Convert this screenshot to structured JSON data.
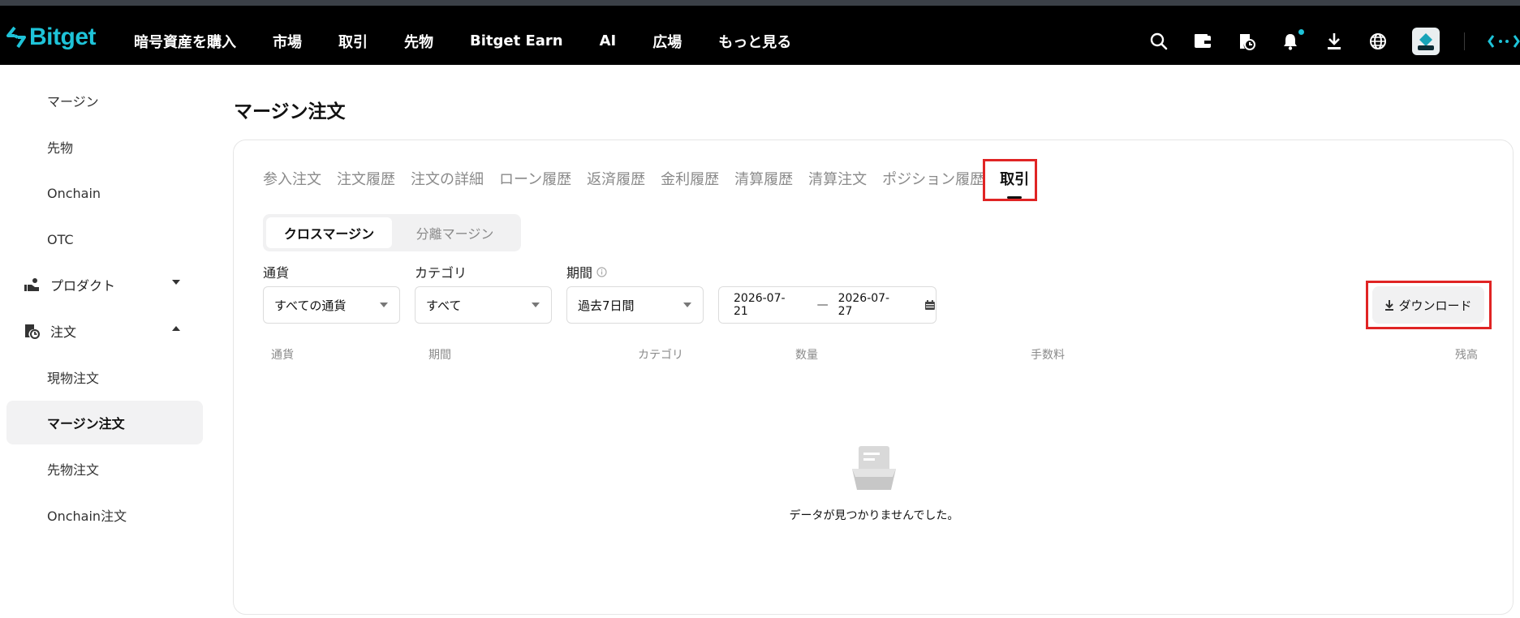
{
  "brand": {
    "name": "Bitget",
    "accent": "#1ec3d8"
  },
  "nav": [
    "暗号資産を購入",
    "市場",
    "取引",
    "先物",
    "Bitget Earn",
    "AI",
    "広場",
    "もっと見る"
  ],
  "top_icons": [
    "search-icon",
    "wallet-icon",
    "order-history-icon",
    "bell-icon",
    "download-icon",
    "globe-icon",
    "avatar",
    "translate-icon"
  ],
  "sidebar": {
    "items": [
      {
        "label": "マージン",
        "type": "sub"
      },
      {
        "label": "先物",
        "type": "sub"
      },
      {
        "label": "Onchain",
        "type": "sub"
      },
      {
        "label": "OTC",
        "type": "sub"
      },
      {
        "label": "プロダクト",
        "type": "group",
        "expanded": false
      },
      {
        "label": "注文",
        "type": "group",
        "expanded": true
      },
      {
        "label": "現物注文",
        "type": "sub"
      },
      {
        "label": "マージン注文",
        "type": "sub",
        "active": true
      },
      {
        "label": "先物注文",
        "type": "sub"
      },
      {
        "label": "Onchain注文",
        "type": "sub"
      }
    ]
  },
  "page": {
    "title": "マージン注文"
  },
  "tabs": [
    {
      "label": "参入注文"
    },
    {
      "label": "注文履歴"
    },
    {
      "label": "注文の詳細"
    },
    {
      "label": "ローン履歴"
    },
    {
      "label": "返済履歴"
    },
    {
      "label": "金利履歴"
    },
    {
      "label": "清算履歴"
    },
    {
      "label": "清算注文"
    },
    {
      "label": "ポジション履歴"
    },
    {
      "label": "取引",
      "active": true
    }
  ],
  "margin_mode": {
    "options": [
      "クロスマージン",
      "分離マージン"
    ],
    "selected": "クロスマージン"
  },
  "filters": {
    "currency": {
      "label": "通貨",
      "value": "すべての通貨"
    },
    "category": {
      "label": "カテゴリ",
      "value": "すべて"
    },
    "period": {
      "label": "期間",
      "value": "過去7日間"
    },
    "date_range": {
      "start": "2026-07-21",
      "end": "2026-07-27"
    }
  },
  "download_label": "ダウンロード",
  "table": {
    "columns": [
      "通貨",
      "期間",
      "カテゴリ",
      "数量",
      "手数料",
      "残高"
    ]
  },
  "empty_message": "データが見つかりませんでした。",
  "highlight_color": "#e02424"
}
